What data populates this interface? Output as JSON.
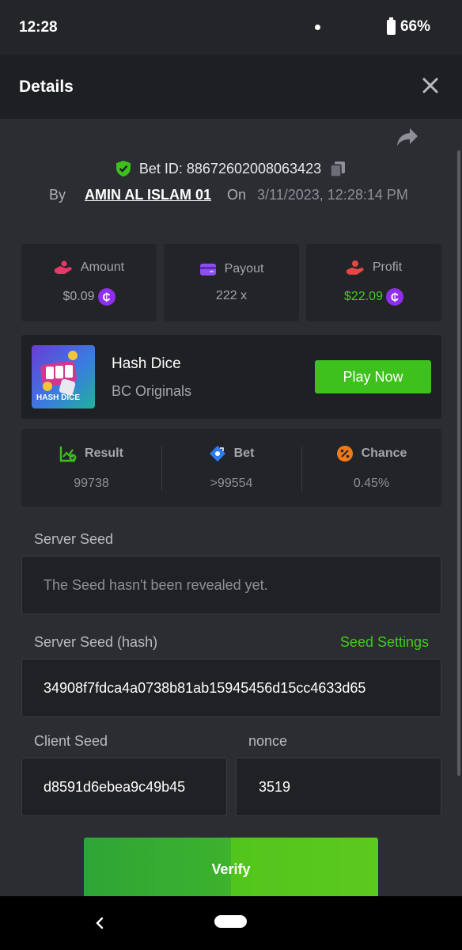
{
  "status": {
    "time": "12:28",
    "battery": "66%"
  },
  "header": {
    "title": "Details"
  },
  "bet": {
    "id_label": "Bet ID: 88672602008063423",
    "by_label": "By",
    "user": "AMIN AL ISLAM 01",
    "on_label": "On",
    "date": "3/11/2023, 12:28:14 PM"
  },
  "stats": {
    "amount_label": "Amount",
    "amount_value": "$0.09",
    "payout_label": "Payout",
    "payout_value": "222 x",
    "profit_label": "Profit",
    "profit_value": "$22.09",
    "coin_symbol": "₵"
  },
  "game": {
    "name": "Hash Dice",
    "provider": "BC Originals",
    "thumb_text": "HASH DICE",
    "play_label": "Play Now"
  },
  "result_stats": {
    "result_label": "Result",
    "result_value": "99738",
    "bet_label": "Bet",
    "bet_value": ">99554",
    "chance_label": "Chance",
    "chance_value": "0.45%"
  },
  "seeds": {
    "server_seed_label": "Server Seed",
    "server_seed_value": "The Seed hasn't been revealed yet.",
    "server_hash_label": "Server Seed (hash)",
    "seed_settings_label": "Seed Settings",
    "server_hash_value": "34908f7fdca4a0738b81ab15945456d15cc4633d65",
    "client_seed_label": "Client Seed",
    "client_seed_value": "d8591d6ebea9c49b45",
    "nonce_label": "nonce",
    "nonce_value": "3519"
  },
  "actions": {
    "verify_label": "Verify"
  },
  "colors": {
    "accent_green": "#3ec01d",
    "coin_purple": "#8f2ef0",
    "bg": "#2b2d32"
  }
}
